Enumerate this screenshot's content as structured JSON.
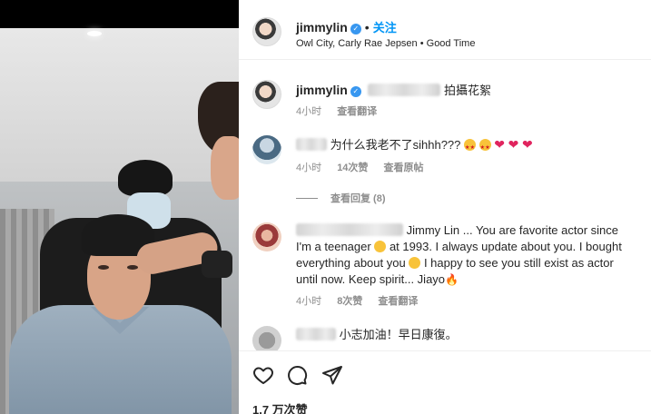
{
  "post": {
    "username": "jimmylin",
    "follow_label": "关注",
    "music": "Owl City, Carly Rae Jepsen • Good Time"
  },
  "caption": {
    "username": "jimmylin",
    "text": "拍攝花絮",
    "time": "4小时",
    "translate": "查看翻译"
  },
  "comments": [
    {
      "text": "为什么我老不了sihhh???",
      "time": "4小时",
      "likes": "14次赞",
      "view_original": "查看原帖",
      "view_replies": "查看回复 (8)"
    },
    {
      "text_line1": "Jimmy Lin ... You are favorite actor since",
      "text_line2a": "I'm a teenager",
      "text_line2b": "at 1993. I always update about you. I bought",
      "text_line3a": "everything about you",
      "text_line3b": "I happy to see you still exist as actor",
      "text_line4": "until now. Keep spirit... Jiayo",
      "time": "4小时",
      "likes": "8次赞",
      "translate": "查看翻译"
    },
    {
      "text": "小志加油！早日康復。"
    }
  ],
  "actions": {
    "likes_count": "1.7 万次赞"
  },
  "colors": {
    "link_blue": "#0095f6",
    "verified_blue": "#3897f0",
    "muted_gray": "#8e8e8e",
    "heart_red": "#e0245e"
  },
  "icons": [
    "verified-badge-icon",
    "heart-icon",
    "comment-icon",
    "share-icon"
  ]
}
